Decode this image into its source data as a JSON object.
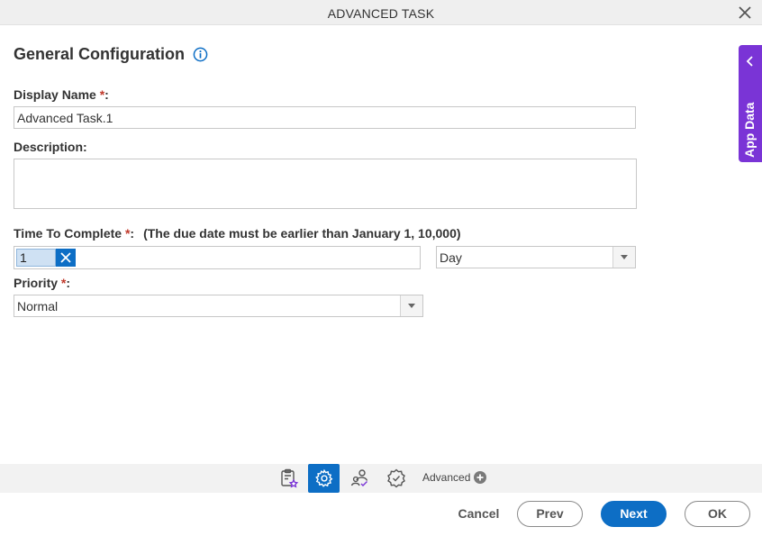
{
  "window": {
    "title": "ADVANCED TASK",
    "close_icon": "close-icon"
  },
  "section": {
    "title": "General Configuration",
    "info_icon": "info-icon"
  },
  "fields": {
    "display_name": {
      "label": "Display Name",
      "required_mark": "*",
      "suffix": ":",
      "value": "Advanced Task.1"
    },
    "description": {
      "label": "Description:",
      "value": ""
    },
    "time_to_complete": {
      "label": "Time To Complete",
      "required_mark": "*",
      "suffix": ":",
      "note": "(The due date must be earlier than January 1, 10,000)",
      "value": "1",
      "unit": "Day"
    },
    "priority": {
      "label": "Priority",
      "required_mark": "*",
      "suffix": ":",
      "value": "Normal"
    }
  },
  "side_panel": {
    "label": "App Data"
  },
  "toolbar": {
    "advanced_label": "Advanced",
    "icons": [
      "task-star-icon",
      "gear-icon",
      "user-check-icon",
      "badge-check-icon",
      "plus-circle-icon"
    ]
  },
  "footer": {
    "cancel": "Cancel",
    "prev": "Prev",
    "next": "Next",
    "ok": "OK"
  },
  "colors": {
    "accent": "#0d6ec5",
    "side_tab": "#7a34d6",
    "required": "#c0392b"
  }
}
